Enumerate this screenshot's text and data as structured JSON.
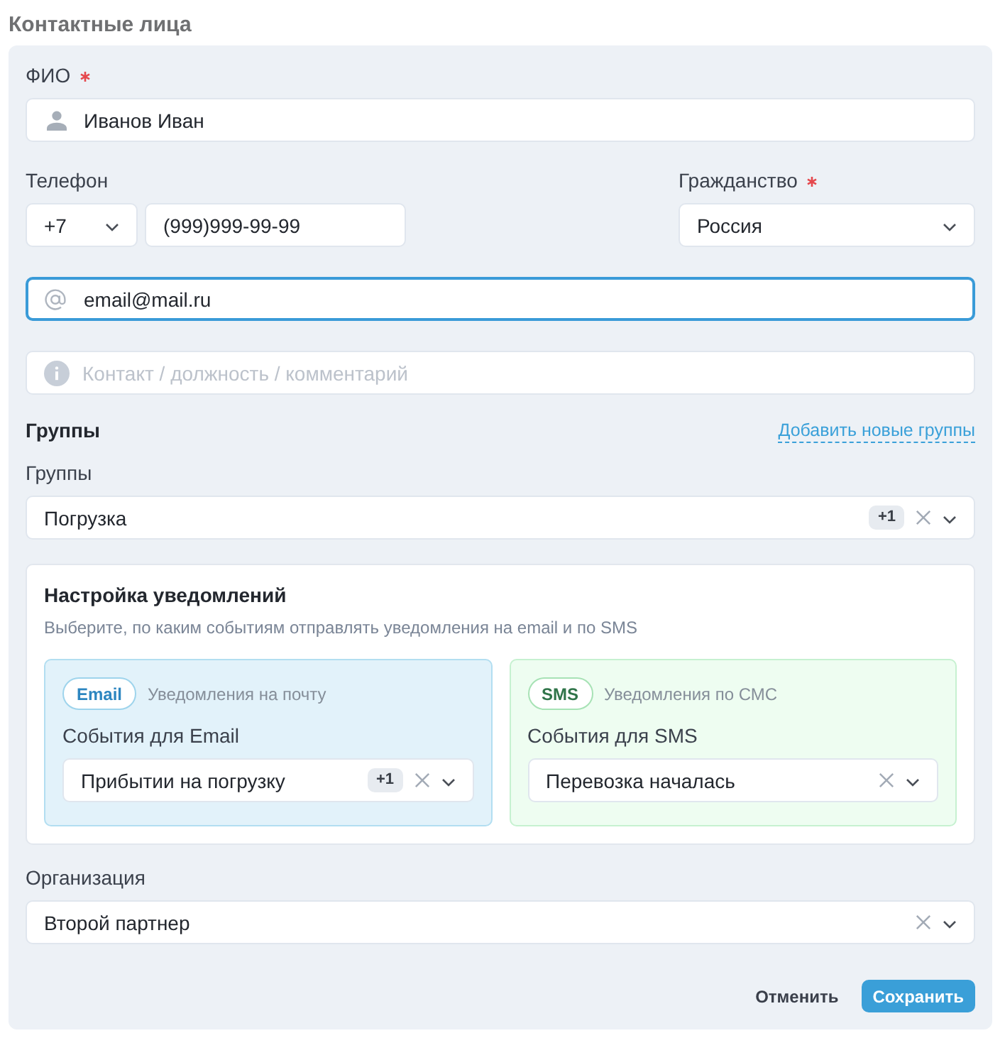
{
  "section": {
    "title": "Контактные лица"
  },
  "full_name": {
    "label": "ФИО",
    "required": true,
    "value": "Иванов Иван"
  },
  "phone": {
    "label": "Телефон",
    "code": {
      "value": "+7"
    },
    "number": "(999)999-99-99"
  },
  "citizenship": {
    "label": "Гражданство",
    "required": true,
    "value": "Россия"
  },
  "email": {
    "value": "email@mail.ru",
    "focused": true
  },
  "comment": {
    "placeholder": "Контакт / должность / комментарий"
  },
  "groups": {
    "heading": "Группы",
    "link": "Добавить новые группы",
    "label": "Группы",
    "value": "Погрузка",
    "extra_count": "+1",
    "clearable": true
  },
  "notifications": {
    "title": "Настройка уведомлений",
    "subtitle": "Выберите, по каким событиям отправлять уведомления на email и по SMS",
    "channels": [
      {
        "kind": "email",
        "tag": "Email",
        "caption": "Уведомления на почту",
        "label": "События для Email",
        "value": "Прибытии на погрузку",
        "extra_count": "+1",
        "clearable": true
      },
      {
        "kind": "sms",
        "tag": "SMS",
        "caption": "Уведомления по СМС",
        "label": "События для SMS",
        "value": "Перевозка началась",
        "clearable": true
      }
    ]
  },
  "organization": {
    "label": "Организация",
    "value": "Второй партнер",
    "clearable": true
  },
  "buttons": [
    {
      "kind": "secondary",
      "label": "Отменить"
    },
    {
      "kind": "primary",
      "label": "Сохранить"
    }
  ]
}
